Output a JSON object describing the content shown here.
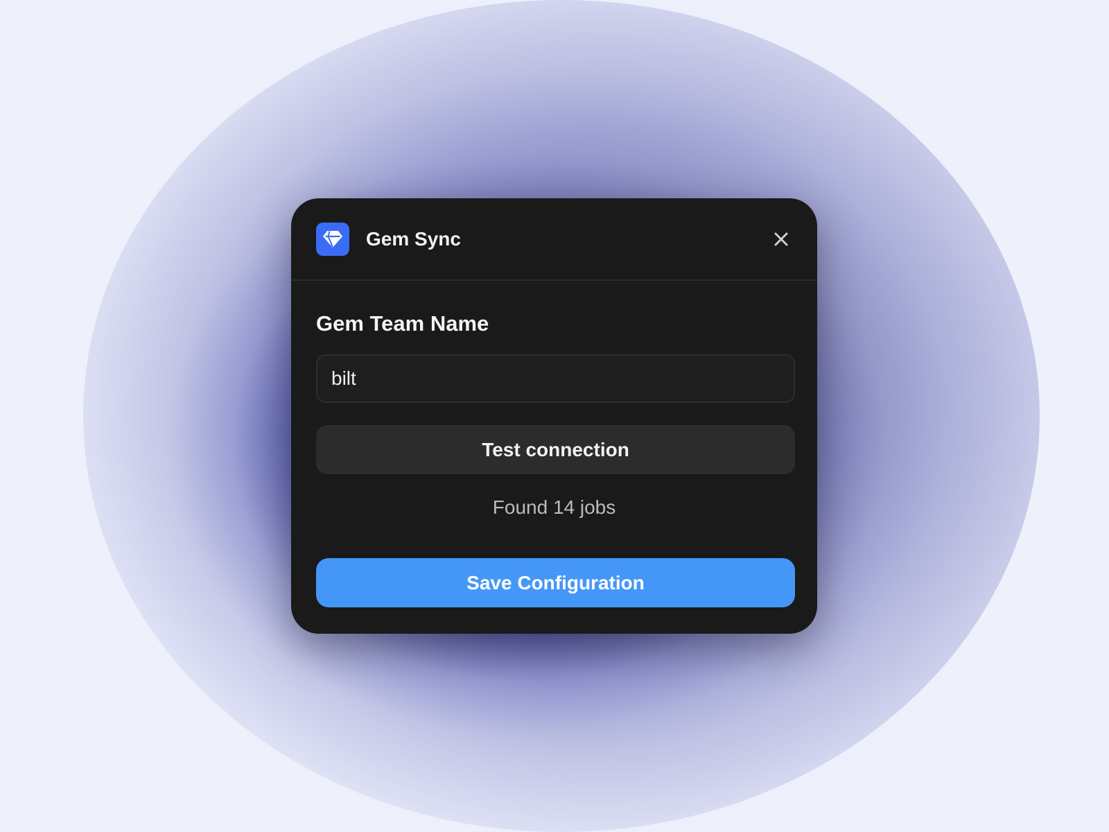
{
  "header": {
    "title": "Gem Sync",
    "app_icon": "gem-icon",
    "close_icon": "close-icon"
  },
  "form": {
    "team_name_label": "Gem Team Name",
    "team_name_value": "bilt",
    "test_button_label": "Test connection",
    "status": "Found 14 jobs",
    "save_button_label": "Save Configuration"
  },
  "colors": {
    "modal_background": "#1a1a1a",
    "app_icon_background": "#3b6cf6",
    "save_button": "#4597f7",
    "test_button": "#2c2c2c"
  }
}
